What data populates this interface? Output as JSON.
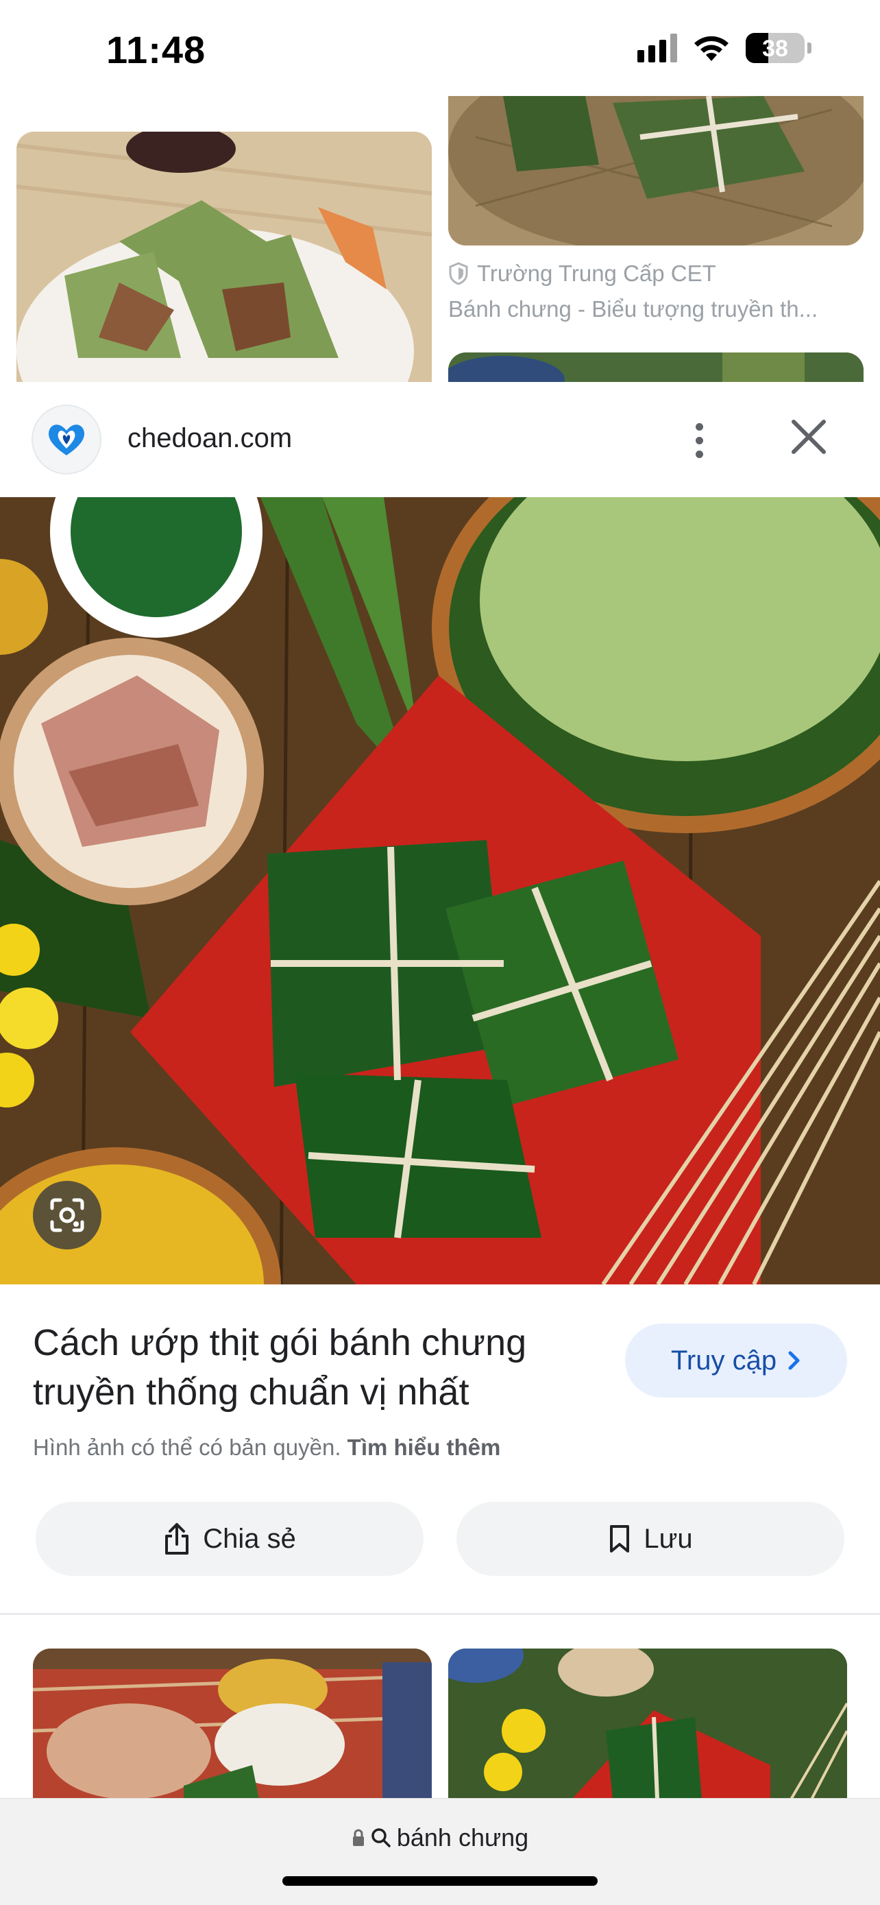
{
  "status_bar": {
    "time": "11:48",
    "battery": "38",
    "battery_level": 0.38
  },
  "grid_top": {
    "right_source": "Trường Trung Cấp CET",
    "right_title": "Bánh chưng - Biểu tượng truyền th..."
  },
  "panel": {
    "site": "chedoan.com",
    "title": "Cách ướp thịt gói bánh chưng truyền thống chuẩn vị nhất",
    "visit_label": "Truy cập",
    "copyright_text": "Hình ảnh có thể có bản quyền.",
    "learn_more": "Tìm hiểu thêm",
    "share_label": "Chia sẻ",
    "save_label": "Lưu"
  },
  "url_bar": {
    "query": "bánh chưng"
  },
  "colors": {
    "accent_blue": "#1a73e8",
    "visit_bg": "#e8f0fe",
    "button_bg": "#f1f3f4"
  },
  "icons": [
    "signal-icon",
    "wifi-icon",
    "battery-icon",
    "shield-icon",
    "site-logo-icon",
    "more-vert-icon",
    "close-icon",
    "lens-icon",
    "chevron-right-icon",
    "share-icon",
    "bookmark-icon",
    "lock-icon",
    "search-icon"
  ]
}
